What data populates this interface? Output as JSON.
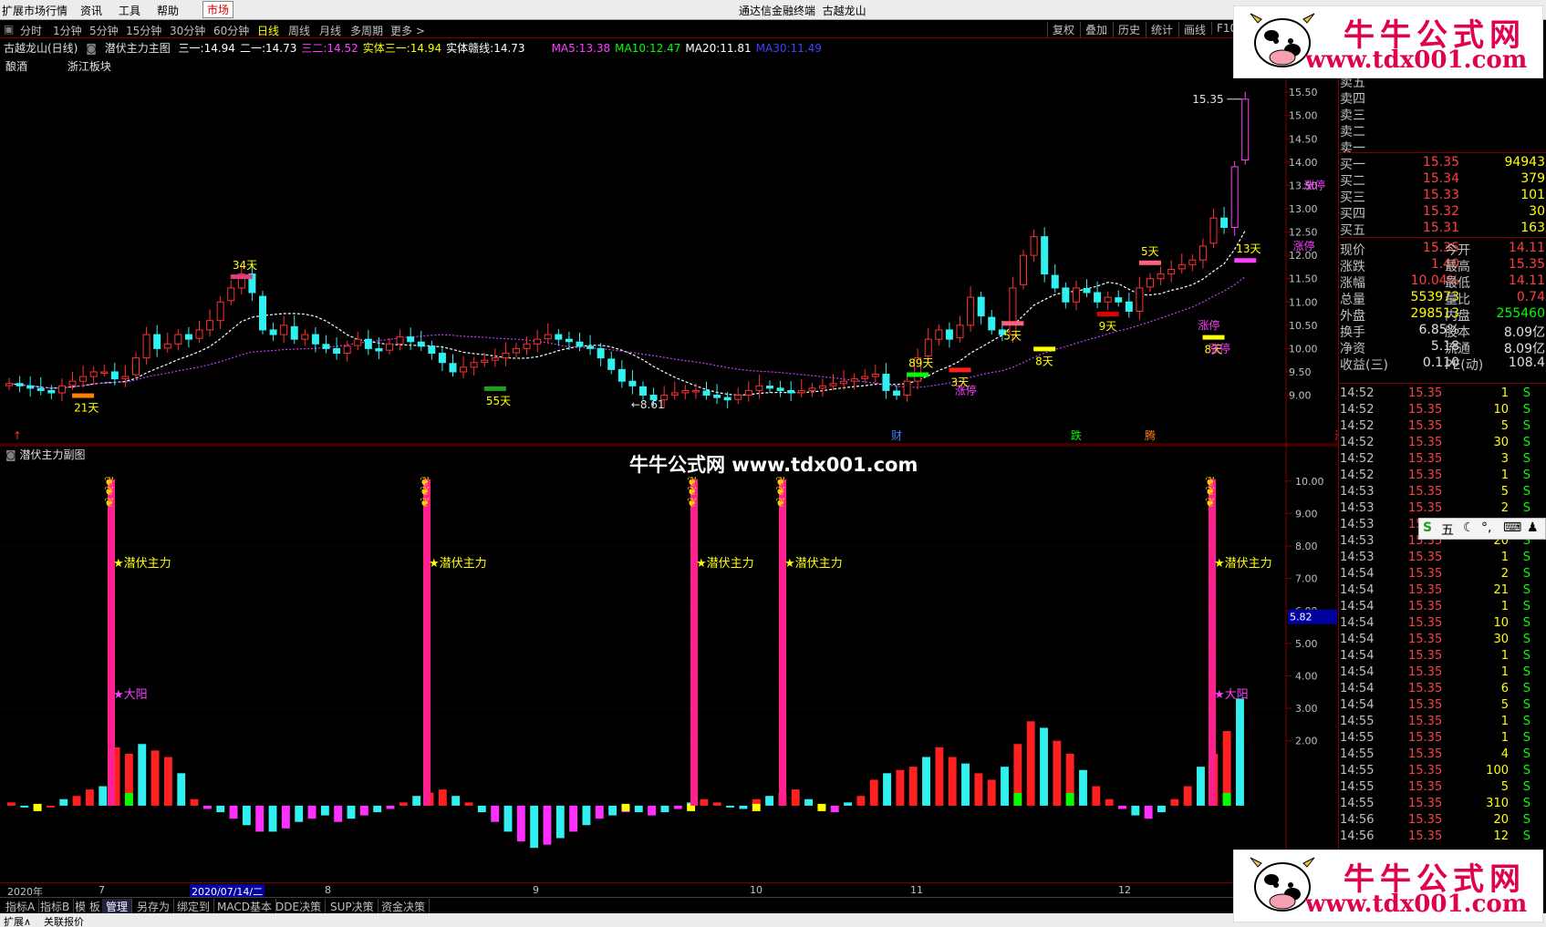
{
  "menubar": {
    "items": [
      "扩展市场行情",
      "资讯",
      "工具",
      "帮助"
    ],
    "market": "市场",
    "title": "通达信金融终端",
    "stock": "古越龙山"
  },
  "periods": {
    "items": [
      "分时",
      "1分钟",
      "5分钟",
      "15分钟",
      "30分钟",
      "60分钟",
      "日线",
      "周线",
      "月线",
      "多周期",
      "更多"
    ],
    "active": "日线",
    "tools": [
      "复权",
      "叠加",
      "历史",
      "统计",
      "画线",
      "F10"
    ]
  },
  "main_header": {
    "name": "古越龙山(日线)",
    "indicator": "潜伏主力主图",
    "fields": [
      {
        "k": "三一:",
        "v": "14.94",
        "color": "#ffffff"
      },
      {
        "k": "二一:",
        "v": "14.73",
        "color": "#ffffff"
      },
      {
        "k": "三二:",
        "v": "14.52",
        "color": "#ff40ff"
      },
      {
        "k": "实体三一:",
        "v": "14.94",
        "color": "#ffff00"
      },
      {
        "k": "实体赣线:",
        "v": "14.73",
        "color": "#ffffff"
      },
      {
        "k": "MA5:",
        "v": "13.38",
        "color": "#ff40ff"
      },
      {
        "k": "MA10:",
        "v": "12.47",
        "color": "#00ff00"
      },
      {
        "k": "MA20:",
        "v": "11.81",
        "color": "#ffffff"
      },
      {
        "k": "MA30:",
        "v": "11.49",
        "color": "#4040ff"
      }
    ],
    "sector": [
      "酿酒",
      "浙江板块"
    ]
  },
  "price_axis": [
    "15.50",
    "15.00",
    "14.50",
    "14.00",
    "13.50",
    "13.00",
    "12.50",
    "12.00",
    "11.50",
    "11.00",
    "10.50",
    "10.00",
    "9.50",
    "9.00"
  ],
  "sub_axis": [
    "10.00",
    "9.00",
    "8.00",
    "7.00",
    "6.00",
    "5.00",
    "4.00",
    "3.00",
    "2.00"
  ],
  "sub_axis_current": "5.82",
  "annotations": {
    "high_label": "15.35",
    "low_label": "8.61",
    "days": [
      "34天",
      "21天",
      "55天",
      "89天",
      "5天",
      "13天",
      "9天",
      "8天",
      "8天",
      "5天",
      "3天"
    ],
    "limit_up": "涨停",
    "events": [
      "财",
      "跌",
      "腾",
      "涨"
    ]
  },
  "sub_header": "潜伏主力副图",
  "signals": {
    "main": "潜伏主力",
    "big_yang": "大阳"
  },
  "watermark": "牛牛公式网 www.tdx001.com",
  "logo": {
    "title": "牛牛公式网",
    "url": "www.tdx001.com"
  },
  "dates": [
    "2020年",
    "7",
    "2020/07/14/二",
    "8",
    "9",
    "10",
    "11",
    "12"
  ],
  "tabs": [
    "指标A",
    "指标B",
    "模 板",
    "管理",
    "另存为",
    "绑定到",
    "MACD基本",
    "DDE决策",
    "SUP决策",
    "资金决策"
  ],
  "status": [
    "扩展∧",
    "关联报价"
  ],
  "orderbook": {
    "sells": [
      "卖五",
      "卖四",
      "卖三",
      "卖二",
      "卖一"
    ],
    "buys": [
      {
        "k": "买一",
        "p": "15.35",
        "v": "94943"
      },
      {
        "k": "买二",
        "p": "15.34",
        "v": "379"
      },
      {
        "k": "买三",
        "p": "15.33",
        "v": "101"
      },
      {
        "k": "买四",
        "p": "15.32",
        "v": "30"
      },
      {
        "k": "买五",
        "p": "15.31",
        "v": "163"
      }
    ]
  },
  "quote": [
    {
      "k1": "现价",
      "v1": "15.35",
      "k2": "今开",
      "v2": "14.11"
    },
    {
      "k1": "涨跌",
      "v1": "1.40",
      "k2": "最高",
      "v2": "15.35"
    },
    {
      "k1": "涨幅",
      "v1": "10.04%",
      "k2": "最低",
      "v2": "14.11"
    },
    {
      "k1": "总量",
      "v1": "553973",
      "k2": "量比",
      "v2": "0.74"
    },
    {
      "k1": "外盘",
      "v1": "298513",
      "k2": "内盘",
      "v2": "255460"
    },
    {
      "k1": "换手",
      "v1": "6.85%",
      "k2": "股本",
      "v2": "8.09亿"
    },
    {
      "k1": "净资",
      "v1": "5.18",
      "k2": "流通",
      "v2": "8.09亿"
    },
    {
      "k1": "收益(三)",
      "v1": "0.110",
      "k2": "PE(动)",
      "v2": "108.4"
    }
  ],
  "ticks": [
    {
      "t": "14:52",
      "p": "15.35",
      "v": "1",
      "s": "S"
    },
    {
      "t": "14:52",
      "p": "15.35",
      "v": "10",
      "s": "S"
    },
    {
      "t": "14:52",
      "p": "15.35",
      "v": "5",
      "s": "S"
    },
    {
      "t": "14:52",
      "p": "15.35",
      "v": "30",
      "s": "S"
    },
    {
      "t": "14:52",
      "p": "15.35",
      "v": "3",
      "s": "S"
    },
    {
      "t": "14:52",
      "p": "15.35",
      "v": "1",
      "s": "S"
    },
    {
      "t": "14:53",
      "p": "15.35",
      "v": "5",
      "s": "S"
    },
    {
      "t": "14:53",
      "p": "15.35",
      "v": "2",
      "s": "S"
    },
    {
      "t": "14:53",
      "p": "15.35",
      "v": "",
      "s": ""
    },
    {
      "t": "14:53",
      "p": "15.35",
      "v": "20",
      "s": "S"
    },
    {
      "t": "14:53",
      "p": "15.35",
      "v": "1",
      "s": "S"
    },
    {
      "t": "14:54",
      "p": "15.35",
      "v": "2",
      "s": "S"
    },
    {
      "t": "14:54",
      "p": "15.35",
      "v": "21",
      "s": "S"
    },
    {
      "t": "14:54",
      "p": "15.35",
      "v": "1",
      "s": "S"
    },
    {
      "t": "14:54",
      "p": "15.35",
      "v": "10",
      "s": "S"
    },
    {
      "t": "14:54",
      "p": "15.35",
      "v": "30",
      "s": "S"
    },
    {
      "t": "14:54",
      "p": "15.35",
      "v": "1",
      "s": "S"
    },
    {
      "t": "14:54",
      "p": "15.35",
      "v": "1",
      "s": "S"
    },
    {
      "t": "14:54",
      "p": "15.35",
      "v": "6",
      "s": "S"
    },
    {
      "t": "14:54",
      "p": "15.35",
      "v": "5",
      "s": "S"
    },
    {
      "t": "14:55",
      "p": "15.35",
      "v": "1",
      "s": "S"
    },
    {
      "t": "14:55",
      "p": "15.35",
      "v": "1",
      "s": "S"
    },
    {
      "t": "14:55",
      "p": "15.35",
      "v": "4",
      "s": "S"
    },
    {
      "t": "14:55",
      "p": "15.35",
      "v": "100",
      "s": "S"
    },
    {
      "t": "14:55",
      "p": "15.35",
      "v": "5",
      "s": "S"
    },
    {
      "t": "14:55",
      "p": "15.35",
      "v": "310",
      "s": "S"
    },
    {
      "t": "14:56",
      "p": "15.35",
      "v": "20",
      "s": "S"
    },
    {
      "t": "14:56",
      "p": "15.35",
      "v": "12",
      "s": "S"
    }
  ],
  "ime": {
    "label": "五"
  },
  "chart_data": {
    "type": "candlestick",
    "y_range": [
      8.6,
      15.6
    ],
    "closes": [
      9.25,
      9.2,
      9.15,
      9.1,
      9.05,
      9.2,
      9.3,
      9.4,
      9.5,
      9.5,
      9.35,
      9.4,
      9.8,
      10.3,
      10.0,
      10.1,
      10.3,
      10.2,
      10.4,
      10.6,
      11.0,
      11.3,
      11.6,
      11.2,
      10.4,
      10.3,
      10.5,
      10.2,
      10.3,
      10.1,
      10.0,
      9.9,
      10.05,
      10.2,
      10.0,
      9.95,
      10.1,
      10.25,
      10.15,
      10.05,
      9.9,
      9.7,
      9.5,
      9.6,
      9.7,
      9.75,
      9.8,
      9.9,
      10.0,
      10.1,
      10.2,
      10.3,
      10.2,
      10.15,
      10.05,
      10.0,
      9.8,
      9.55,
      9.3,
      9.2,
      9.0,
      8.9,
      9.0,
      9.05,
      9.1,
      9.1,
      9.0,
      8.95,
      8.9,
      9.0,
      9.1,
      9.2,
      9.15,
      9.1,
      9.05,
      9.1,
      9.15,
      9.2,
      9.25,
      9.3,
      9.35,
      9.4,
      9.45,
      9.1,
      9.0,
      9.3,
      9.8,
      10.2,
      10.4,
      10.2,
      10.5,
      11.1,
      10.7,
      10.4,
      10.3,
      11.3,
      12.0,
      12.4,
      11.6,
      11.3,
      11.0,
      11.3,
      11.2,
      11.0,
      11.1,
      11.0,
      10.8,
      11.3,
      11.5,
      11.6,
      11.7,
      11.8,
      11.9,
      12.2,
      12.8,
      12.6,
      13.9,
      15.35
    ],
    "sub_series": [
      0.1,
      0.0,
      -0.1,
      0.0,
      0.2,
      0.3,
      0.5,
      0.6,
      1.8,
      1.6,
      1.9,
      1.7,
      1.5,
      1.0,
      0.2,
      -0.1,
      -0.2,
      -0.4,
      -0.6,
      -0.8,
      -0.8,
      -0.7,
      -0.5,
      -0.4,
      -0.3,
      -0.5,
      -0.4,
      -0.3,
      -0.2,
      -0.1,
      0.1,
      0.3,
      0.4,
      0.5,
      0.3,
      0.1,
      -0.2,
      -0.5,
      -0.8,
      -1.1,
      -1.3,
      -1.2,
      -1.0,
      -0.8,
      -0.6,
      -0.4,
      -0.3,
      -0.2,
      -0.2,
      -0.3,
      -0.2,
      -0.1,
      0.1,
      0.2,
      0.1,
      0.0,
      -0.1,
      0.2,
      0.3,
      0.4,
      0.5,
      0.2,
      -0.1,
      -0.2,
      0.1,
      0.3,
      0.8,
      1.0,
      1.1,
      1.2,
      1.5,
      1.8,
      1.5,
      1.3,
      1.0,
      0.8,
      1.2,
      1.9,
      2.6,
      2.4,
      2.0,
      1.6,
      1.1,
      0.6,
      0.2,
      -0.1,
      -0.3,
      -0.4,
      -0.2,
      0.2,
      0.6,
      1.2,
      1.6,
      2.3,
      3.3
    ]
  }
}
